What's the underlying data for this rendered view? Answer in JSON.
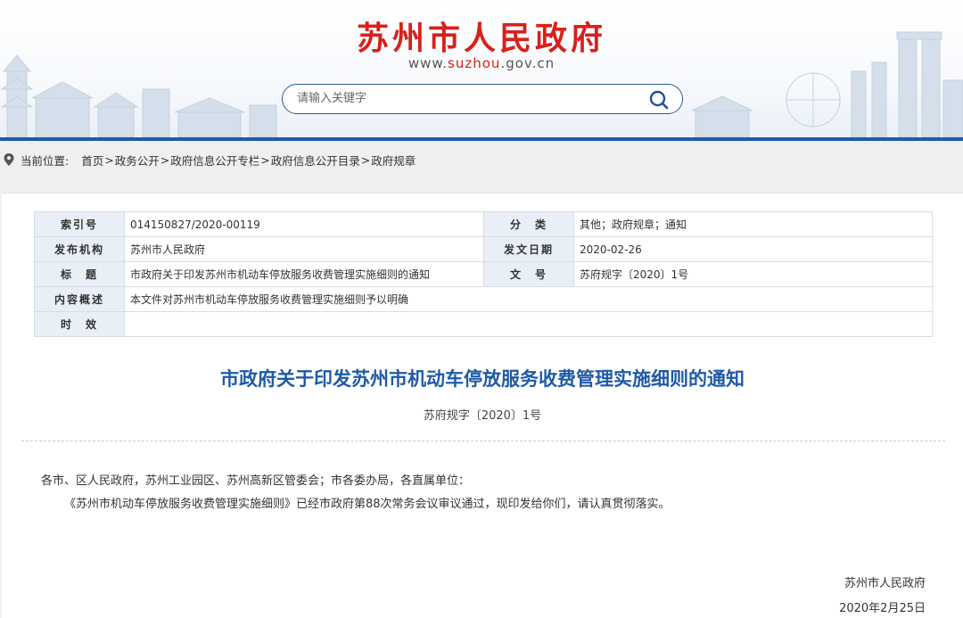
{
  "header": {
    "site_title": "苏州市人民政府",
    "url_prefix": "www.",
    "url_highlight": "suzhou",
    "url_suffix": ".gov.cn",
    "search_placeholder": "请输入关键字"
  },
  "breadcrumb": {
    "label": "当前位置:",
    "items": [
      "首页",
      "政务公开",
      "政府信息公开专栏",
      "政府信息公开目录",
      "政府规章"
    ],
    "separator": ">"
  },
  "meta": {
    "index_label": "索引号",
    "index_value": "014150827/2020-00119",
    "category_label": "分　类",
    "category_value": "其他；政府规章；通知",
    "publisher_label": "发布机构",
    "publisher_value": "苏州市人民政府",
    "date_label": "发文日期",
    "date_value": "2020-02-26",
    "title_label": "标　题",
    "title_value": "市政府关于印发苏州市机动车停放服务收费管理实施细则的通知",
    "docno_label": "文　号",
    "docno_value": "苏府规字〔2020〕1号",
    "summary_label": "内容概述",
    "summary_value": "本文件对苏州市机动车停放服务收费管理实施细则予以明确",
    "validity_label": "时　效",
    "validity_value": ""
  },
  "document": {
    "title": "市政府关于印发苏州市机动车停放服务收费管理实施细则的通知",
    "doc_number": "苏府规字〔2020〕1号",
    "addressee": "各市、区人民政府，苏州工业园区、苏州高新区管委会；市各委办局，各直属单位：",
    "paragraph": "《苏州市机动车停放服务收费管理实施细则》已经市政府第88次常务会议审议通过，现印发给你们，请认真贯彻落实。",
    "signer": "苏州市人民政府",
    "sign_date": "2020年2月25日"
  },
  "colors": {
    "brand_red": "#d8201c",
    "brand_blue": "#1f5aa6",
    "label_bg": "#e9eff6"
  },
  "icons": {
    "search": "magnifier-icon",
    "location": "map-pin-icon"
  }
}
